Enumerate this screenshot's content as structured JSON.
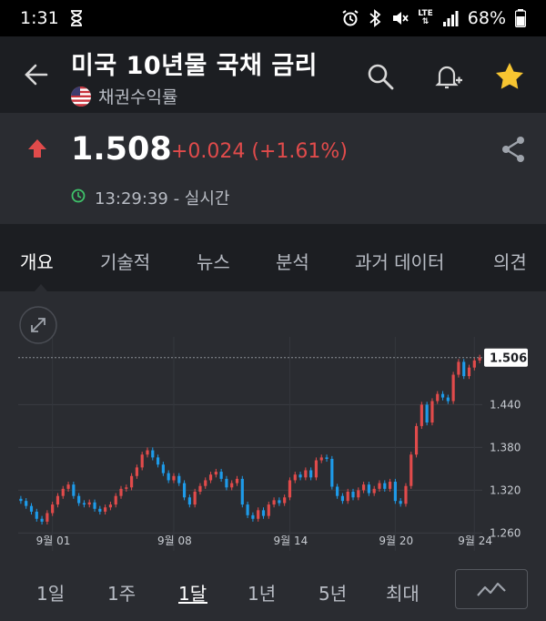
{
  "status_bar": {
    "time": "1:31",
    "battery": "68%",
    "network": "LTE"
  },
  "header": {
    "title": "미국 10년물 국채 금리",
    "subtitle": "채권수익률"
  },
  "quote": {
    "price": "1.508",
    "change": "+0.024 (+1.61%)",
    "time": "13:29:39 - 실시간"
  },
  "tabs": [
    "개요",
    "기술적",
    "뉴스",
    "분석",
    "과거 데이터",
    "의견"
  ],
  "range_buttons": [
    "1일",
    "1주",
    "1달",
    "1년",
    "5년",
    "최대"
  ],
  "colors": {
    "up": "#e14b4b",
    "down": "#1e9be9",
    "background": "#2a2c31",
    "star": "#f7c531",
    "clock": "#3fc36a"
  },
  "chart_data": {
    "type": "candlestick",
    "current_value_label": "1.506",
    "ylim": [
      1.235,
      1.535
    ],
    "y_ticks": [
      "1.440",
      "1.380",
      "1.320",
      "1.260"
    ],
    "x_tick_labels": [
      "9월 01",
      "9월 08",
      "9월 14",
      "9월 20",
      "9월 24"
    ],
    "series": [
      {
        "o": 1.308,
        "c": 1.305
      },
      {
        "o": 1.305,
        "c": 1.298
      },
      {
        "o": 1.298,
        "c": 1.29
      },
      {
        "o": 1.29,
        "c": 1.28
      },
      {
        "o": 1.28,
        "c": 1.276
      },
      {
        "o": 1.276,
        "c": 1.288
      },
      {
        "o": 1.288,
        "c": 1.3
      },
      {
        "o": 1.3,
        "c": 1.312
      },
      {
        "o": 1.312,
        "c": 1.322
      },
      {
        "o": 1.322,
        "c": 1.328
      },
      {
        "o": 1.328,
        "c": 1.312
      },
      {
        "o": 1.312,
        "c": 1.302
      },
      {
        "o": 1.302,
        "c": 1.3
      },
      {
        "o": 1.3,
        "c": 1.303
      },
      {
        "o": 1.303,
        "c": 1.294
      },
      {
        "o": 1.294,
        "c": 1.29
      },
      {
        "o": 1.29,
        "c": 1.296
      },
      {
        "o": 1.296,
        "c": 1.3
      },
      {
        "o": 1.3,
        "c": 1.312
      },
      {
        "o": 1.312,
        "c": 1.322
      },
      {
        "o": 1.322,
        "c": 1.324
      },
      {
        "o": 1.324,
        "c": 1.34
      },
      {
        "o": 1.34,
        "c": 1.352
      },
      {
        "o": 1.352,
        "c": 1.37
      },
      {
        "o": 1.37,
        "c": 1.376
      },
      {
        "o": 1.376,
        "c": 1.366
      },
      {
        "o": 1.366,
        "c": 1.356
      },
      {
        "o": 1.356,
        "c": 1.344
      },
      {
        "o": 1.344,
        "c": 1.334
      },
      {
        "o": 1.334,
        "c": 1.34
      },
      {
        "o": 1.34,
        "c": 1.33
      },
      {
        "o": 1.33,
        "c": 1.31
      },
      {
        "o": 1.31,
        "c": 1.3
      },
      {
        "o": 1.3,
        "c": 1.318
      },
      {
        "o": 1.318,
        "c": 1.326
      },
      {
        "o": 1.326,
        "c": 1.334
      },
      {
        "o": 1.334,
        "c": 1.342
      },
      {
        "o": 1.342,
        "c": 1.346
      },
      {
        "o": 1.346,
        "c": 1.336
      },
      {
        "o": 1.336,
        "c": 1.324
      },
      {
        "o": 1.324,
        "c": 1.33
      },
      {
        "o": 1.33,
        "c": 1.336
      },
      {
        "o": 1.336,
        "c": 1.3
      },
      {
        "o": 1.3,
        "c": 1.285
      },
      {
        "o": 1.285,
        "c": 1.28
      },
      {
        "o": 1.28,
        "c": 1.292
      },
      {
        "o": 1.292,
        "c": 1.284
      },
      {
        "o": 1.284,
        "c": 1.3
      },
      {
        "o": 1.3,
        "c": 1.306
      },
      {
        "o": 1.306,
        "c": 1.302
      },
      {
        "o": 1.302,
        "c": 1.31
      },
      {
        "o": 1.31,
        "c": 1.334
      },
      {
        "o": 1.334,
        "c": 1.342
      },
      {
        "o": 1.342,
        "c": 1.338
      },
      {
        "o": 1.338,
        "c": 1.348
      },
      {
        "o": 1.348,
        "c": 1.338
      },
      {
        "o": 1.338,
        "c": 1.362
      },
      {
        "o": 1.362,
        "c": 1.366
      },
      {
        "o": 1.366,
        "c": 1.364
      },
      {
        "o": 1.364,
        "c": 1.325
      },
      {
        "o": 1.325,
        "c": 1.312
      },
      {
        "o": 1.312,
        "c": 1.305
      },
      {
        "o": 1.305,
        "c": 1.318
      },
      {
        "o": 1.318,
        "c": 1.31
      },
      {
        "o": 1.31,
        "c": 1.32
      },
      {
        "o": 1.32,
        "c": 1.328
      },
      {
        "o": 1.328,
        "c": 1.316
      },
      {
        "o": 1.316,
        "c": 1.322
      },
      {
        "o": 1.322,
        "c": 1.33
      },
      {
        "o": 1.33,
        "c": 1.322
      },
      {
        "o": 1.322,
        "c": 1.332
      },
      {
        "o": 1.332,
        "c": 1.305
      },
      {
        "o": 1.305,
        "c": 1.301
      },
      {
        "o": 1.301,
        "c": 1.326
      },
      {
        "o": 1.326,
        "c": 1.37
      },
      {
        "o": 1.37,
        "c": 1.41
      },
      {
        "o": 1.41,
        "c": 1.44
      },
      {
        "o": 1.44,
        "c": 1.415
      },
      {
        "o": 1.415,
        "c": 1.445
      },
      {
        "o": 1.445,
        "c": 1.455
      },
      {
        "o": 1.455,
        "c": 1.45
      },
      {
        "o": 1.45,
        "c": 1.445
      },
      {
        "o": 1.445,
        "c": 1.482
      },
      {
        "o": 1.482,
        "c": 1.5
      },
      {
        "o": 1.5,
        "c": 1.48
      },
      {
        "o": 1.48,
        "c": 1.492
      },
      {
        "o": 1.492,
        "c": 1.502
      },
      {
        "o": 1.502,
        "c": 1.506
      }
    ]
  }
}
